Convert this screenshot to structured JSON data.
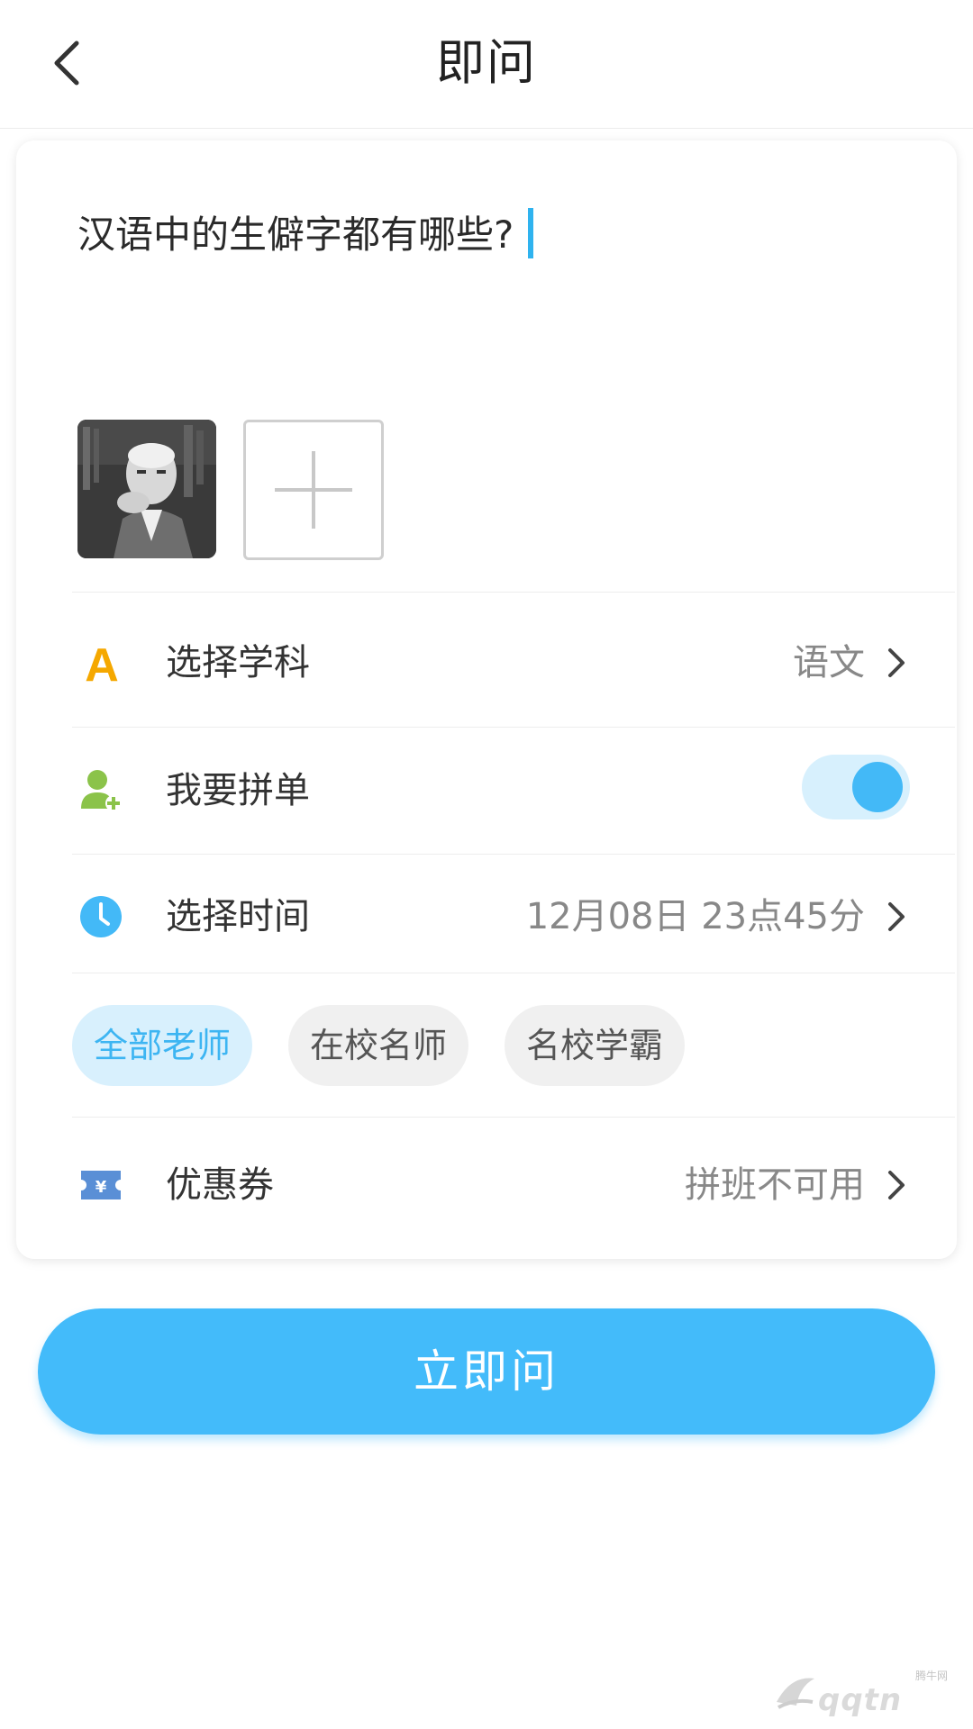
{
  "header": {
    "title": "即问",
    "back_icon": "chevron-left-icon"
  },
  "question": {
    "text": "汉语中的生僻字都有哪些?"
  },
  "attachments": {
    "thumbnail_icon": "portrait-photo",
    "add_icon": "plus-icon"
  },
  "options": {
    "subject": {
      "label": "选择学科",
      "value": "语文",
      "icon": "letter-a-icon",
      "icon_color": "#f5a800"
    },
    "group_buy": {
      "label": "我要拼单",
      "enabled": true,
      "icon": "user-add-icon",
      "icon_color": "#8bc34a"
    },
    "time": {
      "label": "选择时间",
      "value": "12月08日 23点45分",
      "icon": "clock-icon",
      "icon_color": "#43b9f7"
    },
    "coupon": {
      "label": "优惠券",
      "value": "拼班不可用",
      "icon": "ticket-yen-icon",
      "icon_color": "#5a8fd6"
    }
  },
  "teacher_filters": [
    {
      "label": "全部老师",
      "active": true
    },
    {
      "label": "在校名师",
      "active": false
    },
    {
      "label": "名校学霸",
      "active": false
    }
  ],
  "submit": {
    "label": "立即问"
  },
  "colors": {
    "accent": "#43bbfa",
    "chip_active_bg": "#d8f0fd",
    "chip_idle_bg": "#f0f0f0"
  }
}
